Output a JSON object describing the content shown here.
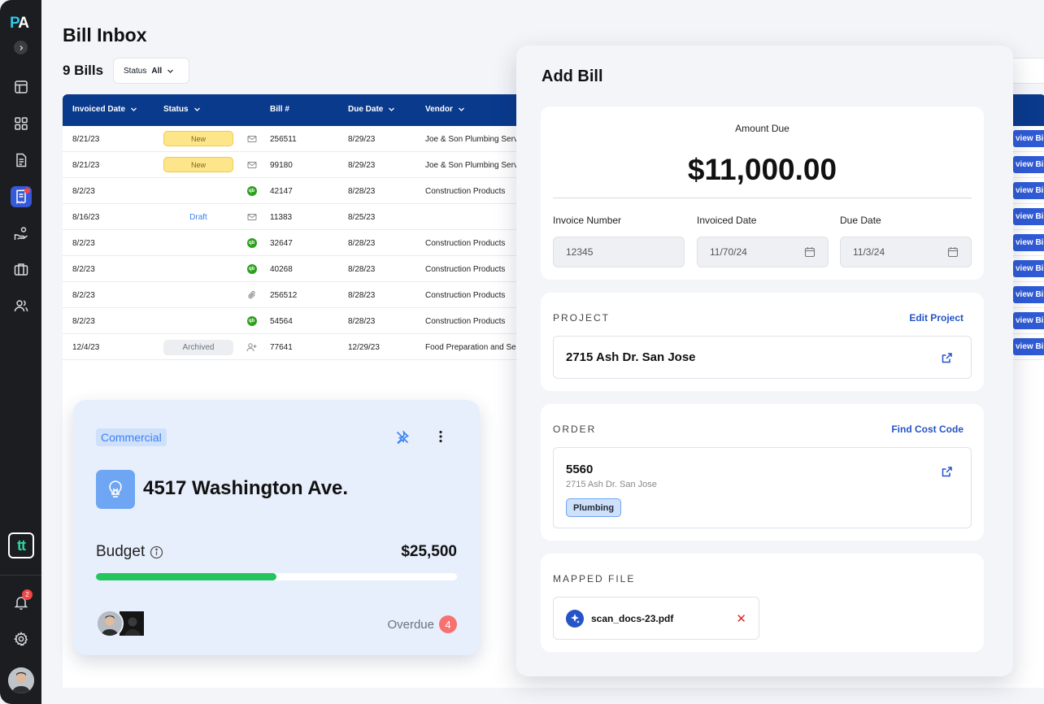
{
  "sidebar": {
    "logo_a": "P",
    "logo_b": "A",
    "tt_label": "tt",
    "notification_count": "2",
    "items": [
      {
        "icon": "layout-icon"
      },
      {
        "icon": "grid-icon"
      },
      {
        "icon": "document-icon"
      },
      {
        "icon": "receipt-icon",
        "active": true
      },
      {
        "icon": "hand-coin-icon"
      },
      {
        "icon": "briefcase-icon"
      },
      {
        "icon": "users-icon"
      }
    ]
  },
  "header": {
    "title": "Bill Inbox",
    "count": "9 Bills",
    "status_filter_label": "Status",
    "status_filter_value": "All"
  },
  "table": {
    "columns": [
      "Invoiced Date",
      "Status",
      "Bill #",
      "Due Date",
      "Vendor"
    ],
    "view_label": "view Bill",
    "rows": [
      {
        "invoiced": "8/21/23",
        "status": "New",
        "source": "mail",
        "bill": "256511",
        "due": "8/29/23",
        "vendor": "Joe & Son Plumbing Serv"
      },
      {
        "invoiced": "8/21/23",
        "status": "New",
        "source": "mail",
        "bill": "99180",
        "due": "8/29/23",
        "vendor": "Joe & Son Plumbing Serv"
      },
      {
        "invoiced": "8/2/23",
        "status": "",
        "source": "qb",
        "bill": "42147",
        "due": "8/28/23",
        "vendor": "Construction Products"
      },
      {
        "invoiced": "8/16/23",
        "status": "Draft",
        "source": "mail",
        "bill": "11383",
        "due": "8/25/23",
        "vendor": ""
      },
      {
        "invoiced": "8/2/23",
        "status": "",
        "source": "qb",
        "bill": "32647",
        "due": "8/28/23",
        "vendor": "Construction Products"
      },
      {
        "invoiced": "8/2/23",
        "status": "",
        "source": "qb",
        "bill": "40268",
        "due": "8/28/23",
        "vendor": "Construction Products"
      },
      {
        "invoiced": "8/2/23",
        "status": "",
        "source": "clip",
        "bill": "256512",
        "due": "8/28/23",
        "vendor": "Construction Products"
      },
      {
        "invoiced": "8/2/23",
        "status": "",
        "source": "qb",
        "bill": "54564",
        "due": "8/28/23",
        "vendor": "Construction Products"
      },
      {
        "invoiced": "12/4/23",
        "status": "Archived",
        "source": "user-plus",
        "bill": "77641",
        "due": "12/29/23",
        "vendor": "Food Preparation and Se"
      }
    ],
    "qb_label": "qb"
  },
  "project_card": {
    "tag": "Commercial",
    "name": "4517 Washington Ave.",
    "budget_label": "Budget",
    "budget_value": "$25,500",
    "budget_progress": 0.5,
    "overdue_label": "Overdue",
    "overdue_count": "4"
  },
  "add_bill": {
    "title": "Add Bill",
    "amount_label": "Amount Due",
    "amount": "$11,000.00",
    "invoice_number_label": "Invoice Number",
    "invoice_number": "12345",
    "invoiced_date_label": "Invoiced Date",
    "invoiced_date": "11/70/24",
    "due_date_label": "Due Date",
    "due_date": "11/3/24",
    "project_title": "PROJECT",
    "project_link": "Edit Project",
    "project_value": "2715 Ash Dr. San Jose",
    "order_title": "ORDER",
    "order_link": "Find Cost Code",
    "order_number": "5560",
    "order_address": "2715 Ash Dr. San Jose",
    "order_tag": "Plumbing",
    "mapped_title": "MAPPED FILE",
    "file_name": "scan_docs-23.pdf",
    "remove_symbol": "✕"
  },
  "colors": {
    "primary": "#0a3a8c",
    "accent": "#2454c8",
    "success": "#22c55e",
    "danger": "#f87171"
  }
}
